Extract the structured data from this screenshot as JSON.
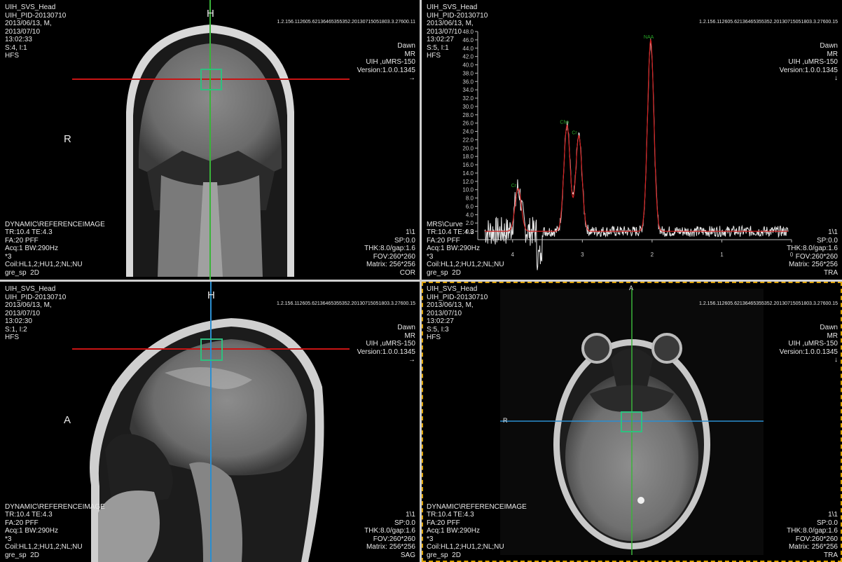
{
  "colors": {
    "crosshair_red": "#c81414",
    "crosshair_green": "#3ab33a",
    "crosshair_blue": "#2b8ed0",
    "voi_box": "#2fbf7f",
    "active_border": "#e0a400"
  },
  "viewports": {
    "cor": {
      "top_left": [
        "UIH_SVS_Head",
        "UIH_PID-20130710",
        "2013/06/13, M,",
        "2013/07/10",
        "13:02:33",
        "S:4, I:1",
        "HFS"
      ],
      "uid": "1.2.156.112605.62136465355352.20130715051803.3.27600.11",
      "top_right": [
        "Dawn",
        "MR",
        "UIH ,uMRS-150",
        "Version:1.0.0.1345",
        "→"
      ],
      "bottom_left": [
        "DYNAMIC\\REFERENCEIMAGE",
        "TR:10.4 TE:4.3",
        "FA:20 PFF",
        "Acq:1 BW:290Hz",
        "*3",
        "Coil:HL1,2;HU1,2;NL;NU",
        "gre_sp  2D"
      ],
      "bottom_right": [
        "1\\1",
        "SP:0.0",
        "THK:8.0/gap:1.6",
        "FOV:260*260",
        "Matrix: 256*256",
        "COR"
      ],
      "orient_top": "H",
      "orient_left": "R"
    },
    "mrs": {
      "top_left": [
        "UIH_SVS_Head",
        "UIH_PID-20130710",
        "2013/06/13, M,",
        "2013/07/10",
        "13:02:27",
        "S:5, I:1",
        "HFS"
      ],
      "uid": "1.2.156.112605.62136465355352.20130715051803.3.27600.15",
      "top_right": [
        "Dawn",
        "MR",
        "UIH ,uMRS-150",
        "Version:1.0.0.1345",
        "↓"
      ],
      "bottom_left": [
        "MRS\\Curve",
        "TR:10.4 TE:4.3",
        "FA:20 PFF",
        "Acq:1 BW:290Hz",
        "*3",
        "Coil:HL1,2;HU1,2;NL;NU",
        "gre_sp  2D"
      ],
      "bottom_right": [
        "1\\1",
        "SP:0.0",
        "THK:8.0/gap:1.6",
        "FOV:260*260",
        "Matrix: 256*256",
        "TRA"
      ]
    },
    "sag": {
      "top_left": [
        "UIH_SVS_Head",
        "UIH_PID-20130710",
        "2013/06/13, M,",
        "2013/07/10",
        "13:02:30",
        "S:1, I:2",
        "HFS"
      ],
      "uid": "1.2.156.112605.62136465355352.20130715051803.3.27600.15",
      "top_right": [
        "Dawn",
        "MR",
        "UIH ,uMRS-150",
        "Version:1.0.0.1345",
        "→"
      ],
      "bottom_left": [
        "DYNAMIC\\REFERENCEIMAGE",
        "TR:10.4 TE:4.3",
        "FA:20 PFF",
        "Acq:1 BW:290Hz",
        "*3",
        "Coil:HL1,2;HU1,2;NL;NU",
        "gre_sp  2D"
      ],
      "bottom_right": [
        "1\\1",
        "SP:0.0",
        "THK:8.0/gap:1.6",
        "FOV:260*260",
        "Matrix: 256*256",
        "SAG"
      ],
      "orient_top": "H",
      "orient_left": "A"
    },
    "tra": {
      "top_left": [
        "UIH_SVS_Head",
        "UIH_PID-20130710",
        "2013/06/13, M,",
        "2013/07/10",
        "13:02:27",
        "S:5, I:3",
        "HFS"
      ],
      "uid": "1.2.156.112605.62136465355352.20130715051803.3.27600.15",
      "top_right": [
        "Dawn",
        "MR",
        "UIH ,uMRS-150",
        "Version:1.0.0.1345",
        "↓"
      ],
      "bottom_left": [
        "DYNAMIC\\REFERENCEIMAGE",
        "TR:10.4 TE:4.3",
        "FA:20 PFF",
        "Acq:1 BW:290Hz",
        "*3",
        "Coil:HL1,2;HU1,2;NL;NU",
        "gre_sp  2D"
      ],
      "bottom_right": [
        "1\\1",
        "SP:0.0",
        "THK:8.0/gap:1.6",
        "FOV:260*260",
        "Matrix: 256*256",
        "TRA"
      ],
      "orient_top": "A",
      "orient_left": "R"
    }
  },
  "chart_data": {
    "type": "line",
    "x_reversed": true,
    "xlim": [
      0,
      4.5
    ],
    "ylim": [
      -2,
      48
    ],
    "x_ticks": [
      "4",
      "3",
      "2",
      "1",
      "0"
    ],
    "y_ticks": [
      "0.0",
      "2.0",
      "4.0",
      "6.0",
      "8.0",
      "10.0",
      "12.0",
      "14.0",
      "16.0",
      "18.0",
      "20.0",
      "22.0",
      "24.0",
      "26.0",
      "28.0",
      "30.0",
      "32.0",
      "34.0",
      "36.0",
      "38.0",
      "40.0",
      "42.0",
      "44.0",
      "46.0",
      "48.0"
    ],
    "peaks": [
      {
        "label": "Cr",
        "ppm": 3.92,
        "height": 10.3
      },
      {
        "label": "Cho",
        "ppm": 3.22,
        "height": 25.5
      },
      {
        "label": "Cr",
        "ppm": 3.05,
        "height": 23.0
      },
      {
        "label": "NAA",
        "ppm": 2.02,
        "height": 46.0
      }
    ],
    "series": [
      {
        "color": "#e8e8e8"
      },
      {
        "color": "#d42020"
      }
    ]
  }
}
